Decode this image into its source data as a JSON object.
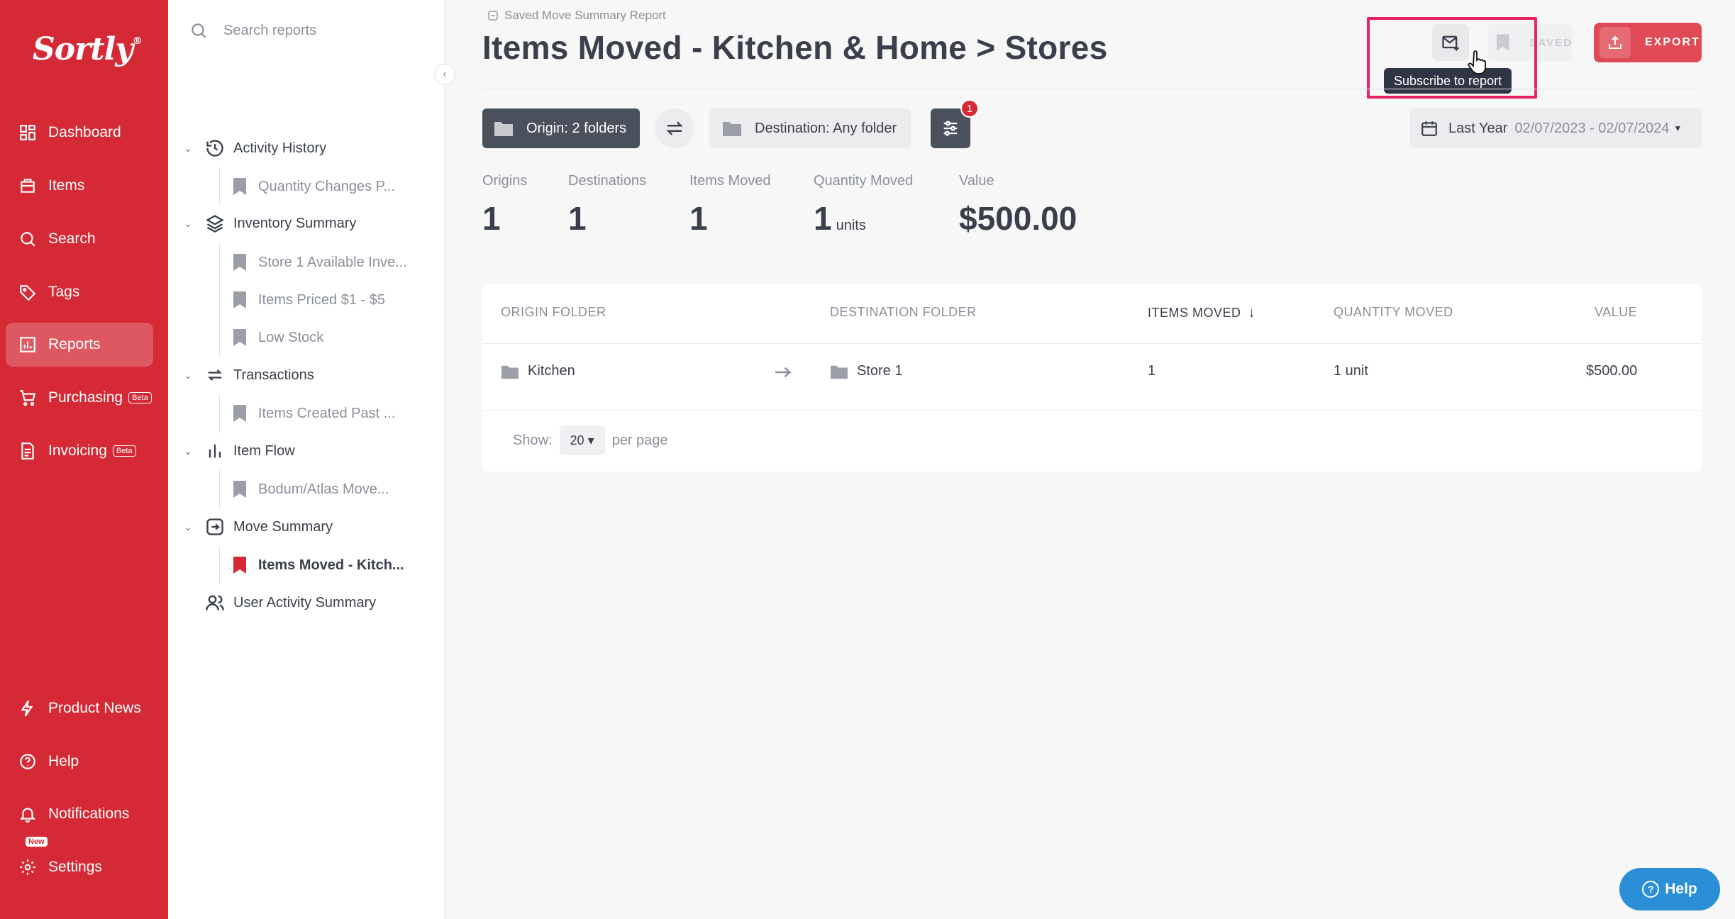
{
  "brand": {
    "logo": "Sortly",
    "mark": "®"
  },
  "nav": {
    "items": [
      {
        "label": "Dashboard"
      },
      {
        "label": "Items"
      },
      {
        "label": "Search"
      },
      {
        "label": "Tags"
      },
      {
        "label": "Reports"
      },
      {
        "label": "Purchasing",
        "badge": "Beta"
      },
      {
        "label": "Invoicing",
        "badge": "Beta"
      }
    ],
    "bottom": [
      {
        "label": "Product News"
      },
      {
        "label": "Help"
      },
      {
        "label": "Notifications"
      },
      {
        "label": "Settings",
        "badge": "New"
      }
    ]
  },
  "sidebar": {
    "search_placeholder": "Search reports",
    "groups": [
      {
        "label": "Activity History",
        "items": [
          "Quantity Changes P..."
        ]
      },
      {
        "label": "Inventory Summary",
        "items": [
          "Store 1 Available Inve...",
          "Items Priced $1 - $5",
          "Low Stock"
        ]
      },
      {
        "label": "Transactions",
        "items": [
          "Items Created Past ..."
        ]
      },
      {
        "label": "Item Flow",
        "items": [
          "Bodum/Atlas Move..."
        ]
      },
      {
        "label": "Move Summary",
        "items": [
          "Items Moved - Kitch..."
        ]
      },
      {
        "label": "User Activity Summary",
        "items": []
      }
    ]
  },
  "header": {
    "breadcrumb": "Saved Move Summary Report",
    "title": "Items Moved - Kitchen & Home > Stores",
    "saved_label": "SAVED",
    "export_label": "EXPORT",
    "tooltip": "Subscribe to report"
  },
  "filters": {
    "origin": "Origin: 2 folders",
    "destination": "Destination: Any folder",
    "filter_count": "1",
    "date_label": "Last Year",
    "date_range": "02/07/2023 - 02/07/2024"
  },
  "stats": [
    {
      "label": "Origins",
      "value": "1"
    },
    {
      "label": "Destinations",
      "value": "1"
    },
    {
      "label": "Items Moved",
      "value": "1"
    },
    {
      "label": "Quantity Moved",
      "value": "1",
      "unit": "units"
    },
    {
      "label": "Value",
      "value": "$500.00"
    }
  ],
  "table": {
    "columns": [
      "ORIGIN FOLDER",
      "DESTINATION FOLDER",
      "ITEMS MOVED",
      "QUANTITY MOVED",
      "VALUE"
    ],
    "rows": [
      {
        "origin": "Kitchen",
        "destination": "Store 1",
        "items_moved": "1",
        "quantity": "1 unit",
        "value": "$500.00"
      }
    ],
    "show_label": "Show:",
    "per_page_value": "20",
    "per_page_label": "per page"
  },
  "help_button": "Help",
  "colors": {
    "brand_red": "#d52935",
    "highlight": "#e8235f",
    "help_blue": "#2a8fd6"
  }
}
